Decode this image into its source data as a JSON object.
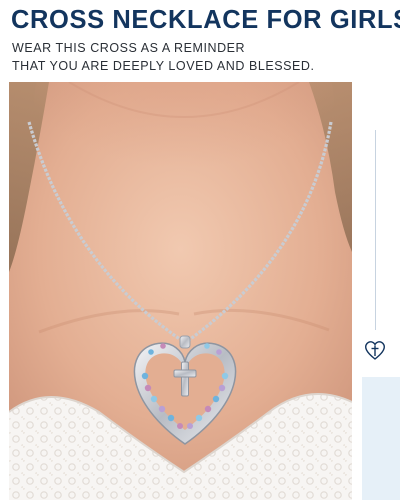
{
  "header": {
    "title": "CROSS NECKLACE FOR GIRLS",
    "subtitle_line1": "WEAR THIS CROSS AS A REMINDER",
    "subtitle_line2": "THAT YOU ARE DEEPLY LOVED AND BLESSED."
  },
  "product": {
    "pendant": "heart-with-cross",
    "stone_colors": [
      "#6fb3dd",
      "#c58ab8",
      "#8fc9e6",
      "#b9a0d4"
    ]
  },
  "side_decoration": {
    "icon": "heart-cross-icon",
    "accent_color": "#e6f0f8"
  },
  "colors": {
    "title": "#13355e",
    "text": "#2a2f36"
  }
}
